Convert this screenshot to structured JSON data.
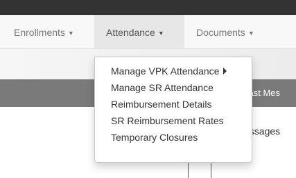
{
  "nav": {
    "enrollments_label": "Enrollments",
    "attendance_label": "Attendance",
    "documents_label": "Documents"
  },
  "attendance_menu": {
    "items": [
      {
        "label": "Manage VPK Attendance",
        "has_submenu": true
      },
      {
        "label": "Manage SR Attendance"
      },
      {
        "label": "Reimbursement Details"
      },
      {
        "label": "SR Reimbursement Rates"
      },
      {
        "label": "Temporary Closures"
      }
    ]
  },
  "band": {
    "text": "cast Mes"
  },
  "content": {
    "text": "essages"
  },
  "colors": {
    "topbar": "#333333",
    "navbar": "#f8f8f8",
    "nav_open": "#e7e7e7",
    "band": "#7a7a7a"
  }
}
